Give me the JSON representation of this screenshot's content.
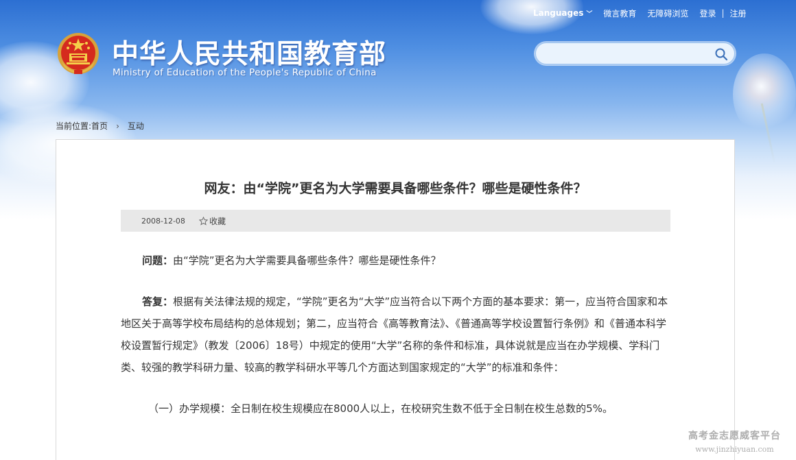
{
  "header": {
    "languages_label": "Languages",
    "links": [
      "微言教育",
      "无障碍浏览"
    ],
    "login": "登录",
    "separator": "|",
    "register": "注册",
    "logo_cn": "中华人民共和国教育部",
    "logo_en": "Ministry of Education of the People's Republic of China",
    "search_placeholder": ""
  },
  "breadcrumb": {
    "label": "当前位置:",
    "home": "首页",
    "current": "互动"
  },
  "article": {
    "title": "网友：由“学院”更名为大学需要具备哪些条件？哪些是硬性条件？",
    "date": "2008-12-08",
    "favorite": "收藏",
    "question_label": "问题：",
    "question_text": "由“学院”更名为大学需要具备哪些条件？哪些是硬性条件？",
    "answer_label": "答复：",
    "answer_text": "根据有关法律法规的规定，“学院”更名为“大学”应当符合以下两个方面的基本要求：第一，应当符合国家和本地区关于高等学校布局结构的总体规划；第二，应当符合《高等教育法》、《普通高等学校设置暂行条例》和《普通本科学校设置暂行规定》（教发〔2006〕18号）中规定的使用“大学”名称的条件和标准，具体说就是应当在办学规模、学科门类、较强的教学科研力量、较高的教学科研水平等几个方面达到国家规定的“大学”的标准和条件：",
    "item1": "（一）办学规模：全日制在校生规模应在8000人以上，在校研究生数不低于全日制在校生总数的5%。"
  },
  "watermark": {
    "line1": "高考金志愿威客平台",
    "line2": "www.jinzhiyuan.com"
  },
  "colors": {
    "header_blue": "#2c6fd2",
    "meta_bar": "#e8e8e8",
    "text": "#333333"
  }
}
